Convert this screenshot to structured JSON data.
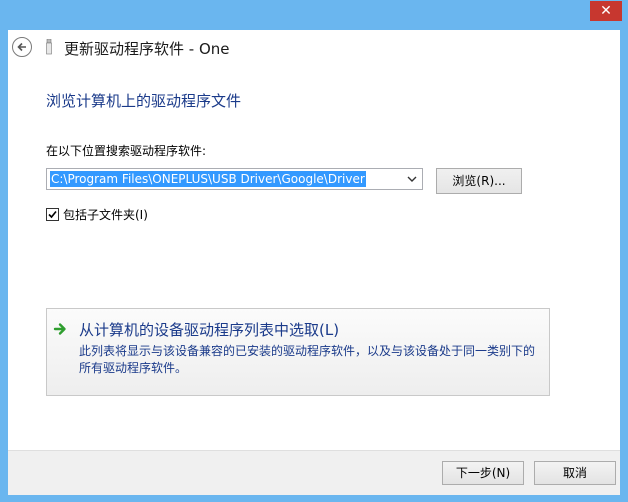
{
  "window": {
    "title": "更新驱动程序软件 - One",
    "close_glyph": "✕"
  },
  "main": {
    "heading": "浏览计算机上的驱动程序文件",
    "search_label": "在以下位置搜索驱动程序软件:",
    "path_value": "C:\\Program Files\\ONEPLUS\\USB Driver\\Google\\Driver",
    "browse_label": "浏览(R)...",
    "include_subfolders_label": "包括子文件夹(I)",
    "include_subfolders_checked": true
  },
  "pick_option": {
    "title": "从计算机的设备驱动程序列表中选取(L)",
    "description": "此列表将显示与该设备兼容的已安装的驱动程序软件，以及与该设备处于同一类别下的所有驱动程序软件。"
  },
  "footer": {
    "next_label": "下一步(N)",
    "cancel_label": "取消"
  },
  "colors": {
    "frame": "#6ab6ef",
    "close": "#c7372f",
    "link_blue": "#1a3a8a",
    "selection": "#3399ff",
    "arrow_green": "#2f9e2f"
  }
}
